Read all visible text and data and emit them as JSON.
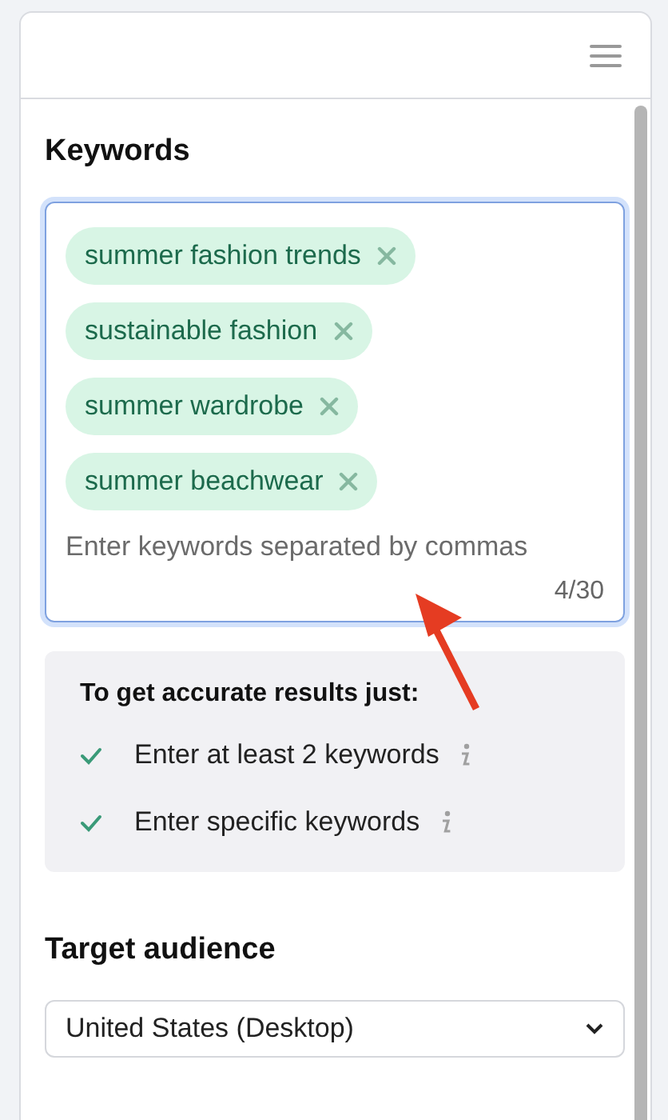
{
  "keywords": {
    "title": "Keywords",
    "tags": [
      {
        "label": "summer fashion trends"
      },
      {
        "label": "sustainable fashion"
      },
      {
        "label": "summer wardrobe"
      },
      {
        "label": "summer beachwear"
      }
    ],
    "placeholder": "Enter keywords separated by commas",
    "counter": "4/30"
  },
  "tips": {
    "title": "To get accurate results just:",
    "items": [
      {
        "text": "Enter at least 2 keywords",
        "met": true
      },
      {
        "text": "Enter specific keywords",
        "met": true
      }
    ]
  },
  "audience": {
    "title": "Target audience",
    "value": "United States (Desktop)"
  }
}
